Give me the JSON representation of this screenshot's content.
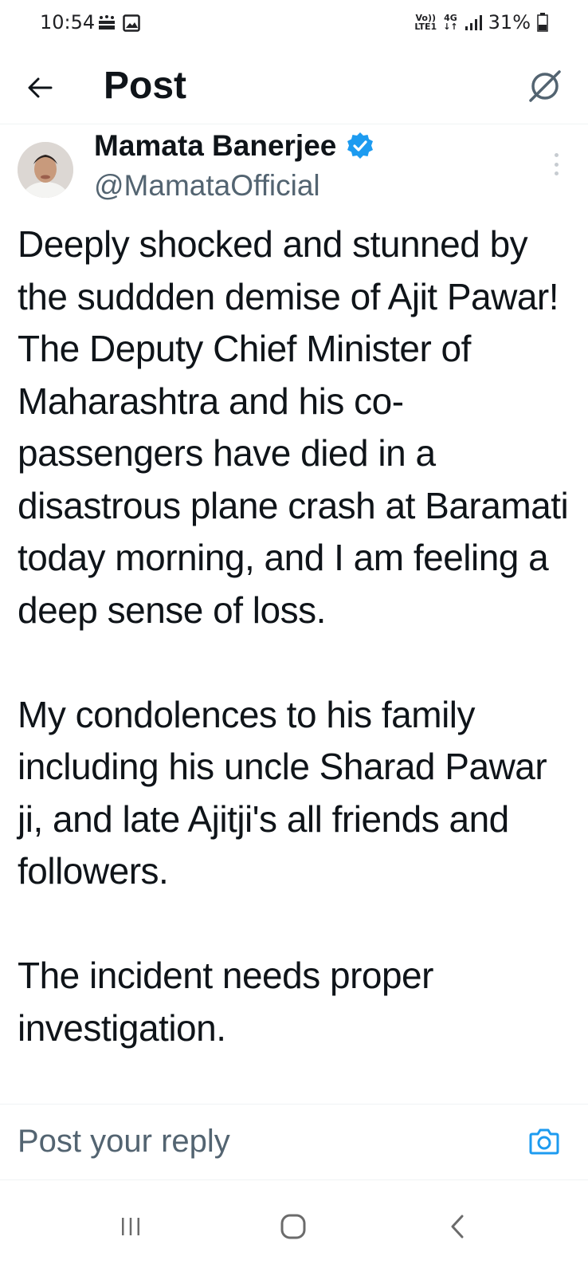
{
  "status_bar": {
    "time": "10:54",
    "network_top": "Vo))",
    "network_bottom": "LTE1",
    "network_type": "4G",
    "battery": "31%"
  },
  "header": {
    "title": "Post"
  },
  "post": {
    "author_name": "Mamata Banerjee",
    "author_handle": "@MamataOfficial",
    "text": "Deeply shocked and stunned by the suddden demise of Ajit Pawar! The Deputy Chief Minister of Maharashtra and his co-passengers have died in a disastrous plane crash at Baramati today morning, and I am feeling a deep sense of loss.\n\nMy condolences to his family including his uncle Sharad Pawar ji, and late Ajitji's all friends and followers.\n\nThe incident needs proper investigation."
  },
  "reply": {
    "placeholder": "Post your reply"
  },
  "colors": {
    "accent": "#1d9bf0",
    "text_primary": "#0f1419",
    "text_secondary": "#536471"
  },
  "icons": {
    "back": "arrow-left-icon",
    "grok": "grok-icon",
    "verified": "verified-badge-icon",
    "more": "more-vertical-icon",
    "camera": "camera-icon",
    "nav_recents": "recents-icon",
    "nav_home": "home-icon",
    "nav_back": "nav-back-icon"
  }
}
